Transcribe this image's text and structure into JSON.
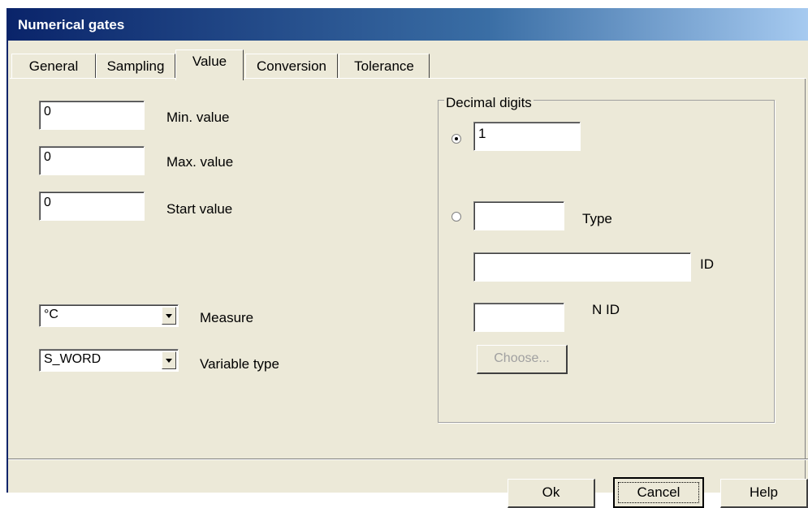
{
  "window": {
    "title": "Numerical gates"
  },
  "tabs": [
    {
      "label": "General"
    },
    {
      "label": "Sampling"
    },
    {
      "label": "Value"
    },
    {
      "label": "Conversion"
    },
    {
      "label": "Tolerance"
    }
  ],
  "active_tab": "Value",
  "value_tab": {
    "min_value": {
      "value": "0",
      "label": "Min. value"
    },
    "max_value": {
      "value": "0",
      "label": "Max. value"
    },
    "start_value": {
      "value": "0",
      "label": "Start value"
    },
    "measure": {
      "selected": "°C",
      "label": "Measure"
    },
    "variable_type": {
      "selected": "S_WORD",
      "label": "Variable type"
    }
  },
  "decimal_digits": {
    "title": "Decimal digits",
    "fixed": {
      "checked": true,
      "value": "1"
    },
    "variable": {
      "checked": false,
      "type_value": "",
      "type_label": "Type",
      "id_value": "",
      "id_label": "ID",
      "nid_value": "",
      "nid_label": "N ID",
      "choose_label": "Choose..."
    }
  },
  "footer": {
    "ok_label": "Ok",
    "cancel_label": "Cancel",
    "help_label": "Help"
  }
}
